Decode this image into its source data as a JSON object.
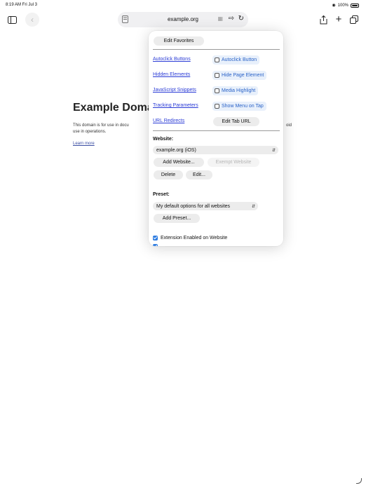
{
  "status": {
    "time": "8:19 AM  Fri Jul 3",
    "battery": "100%"
  },
  "toolbar": {
    "url": "example.org",
    "icons": [
      "sidebar-icon",
      "back-icon",
      "reader-icon",
      "extension-icon",
      "extension-active-icon",
      "reload-icon",
      "share-icon",
      "plus-icon",
      "tabs-icon"
    ]
  },
  "page": {
    "heading": "Example Doma",
    "body_left": "This domain is for use in docu",
    "body_left2": "use in operations.",
    "body_right": "oid",
    "link": "Learn more"
  },
  "popover": {
    "edit_favorites": "Edit Favorites",
    "links": [
      "Autoclick Buttons",
      "Hidden Elements",
      "JavaScript Snippets",
      "Tracking Parameters",
      "URL Redirects"
    ],
    "toggles": [
      "Autoclick Button",
      "Hide Page Element",
      "Media Highlight",
      "Show Menu on Tap"
    ],
    "edit_tab_url": "Edit Tab URL",
    "website_label": "Website:",
    "website_select": "example.org (iOS)",
    "add_website": "Add Website...",
    "exempt_website": "Exempt Website",
    "delete": "Delete",
    "edit": "Edit...",
    "preset_label": "Preset:",
    "preset_select": "My default options for all websites",
    "add_preset": "Add Preset...",
    "extension_enabled": "Extension Enabled on Website"
  }
}
